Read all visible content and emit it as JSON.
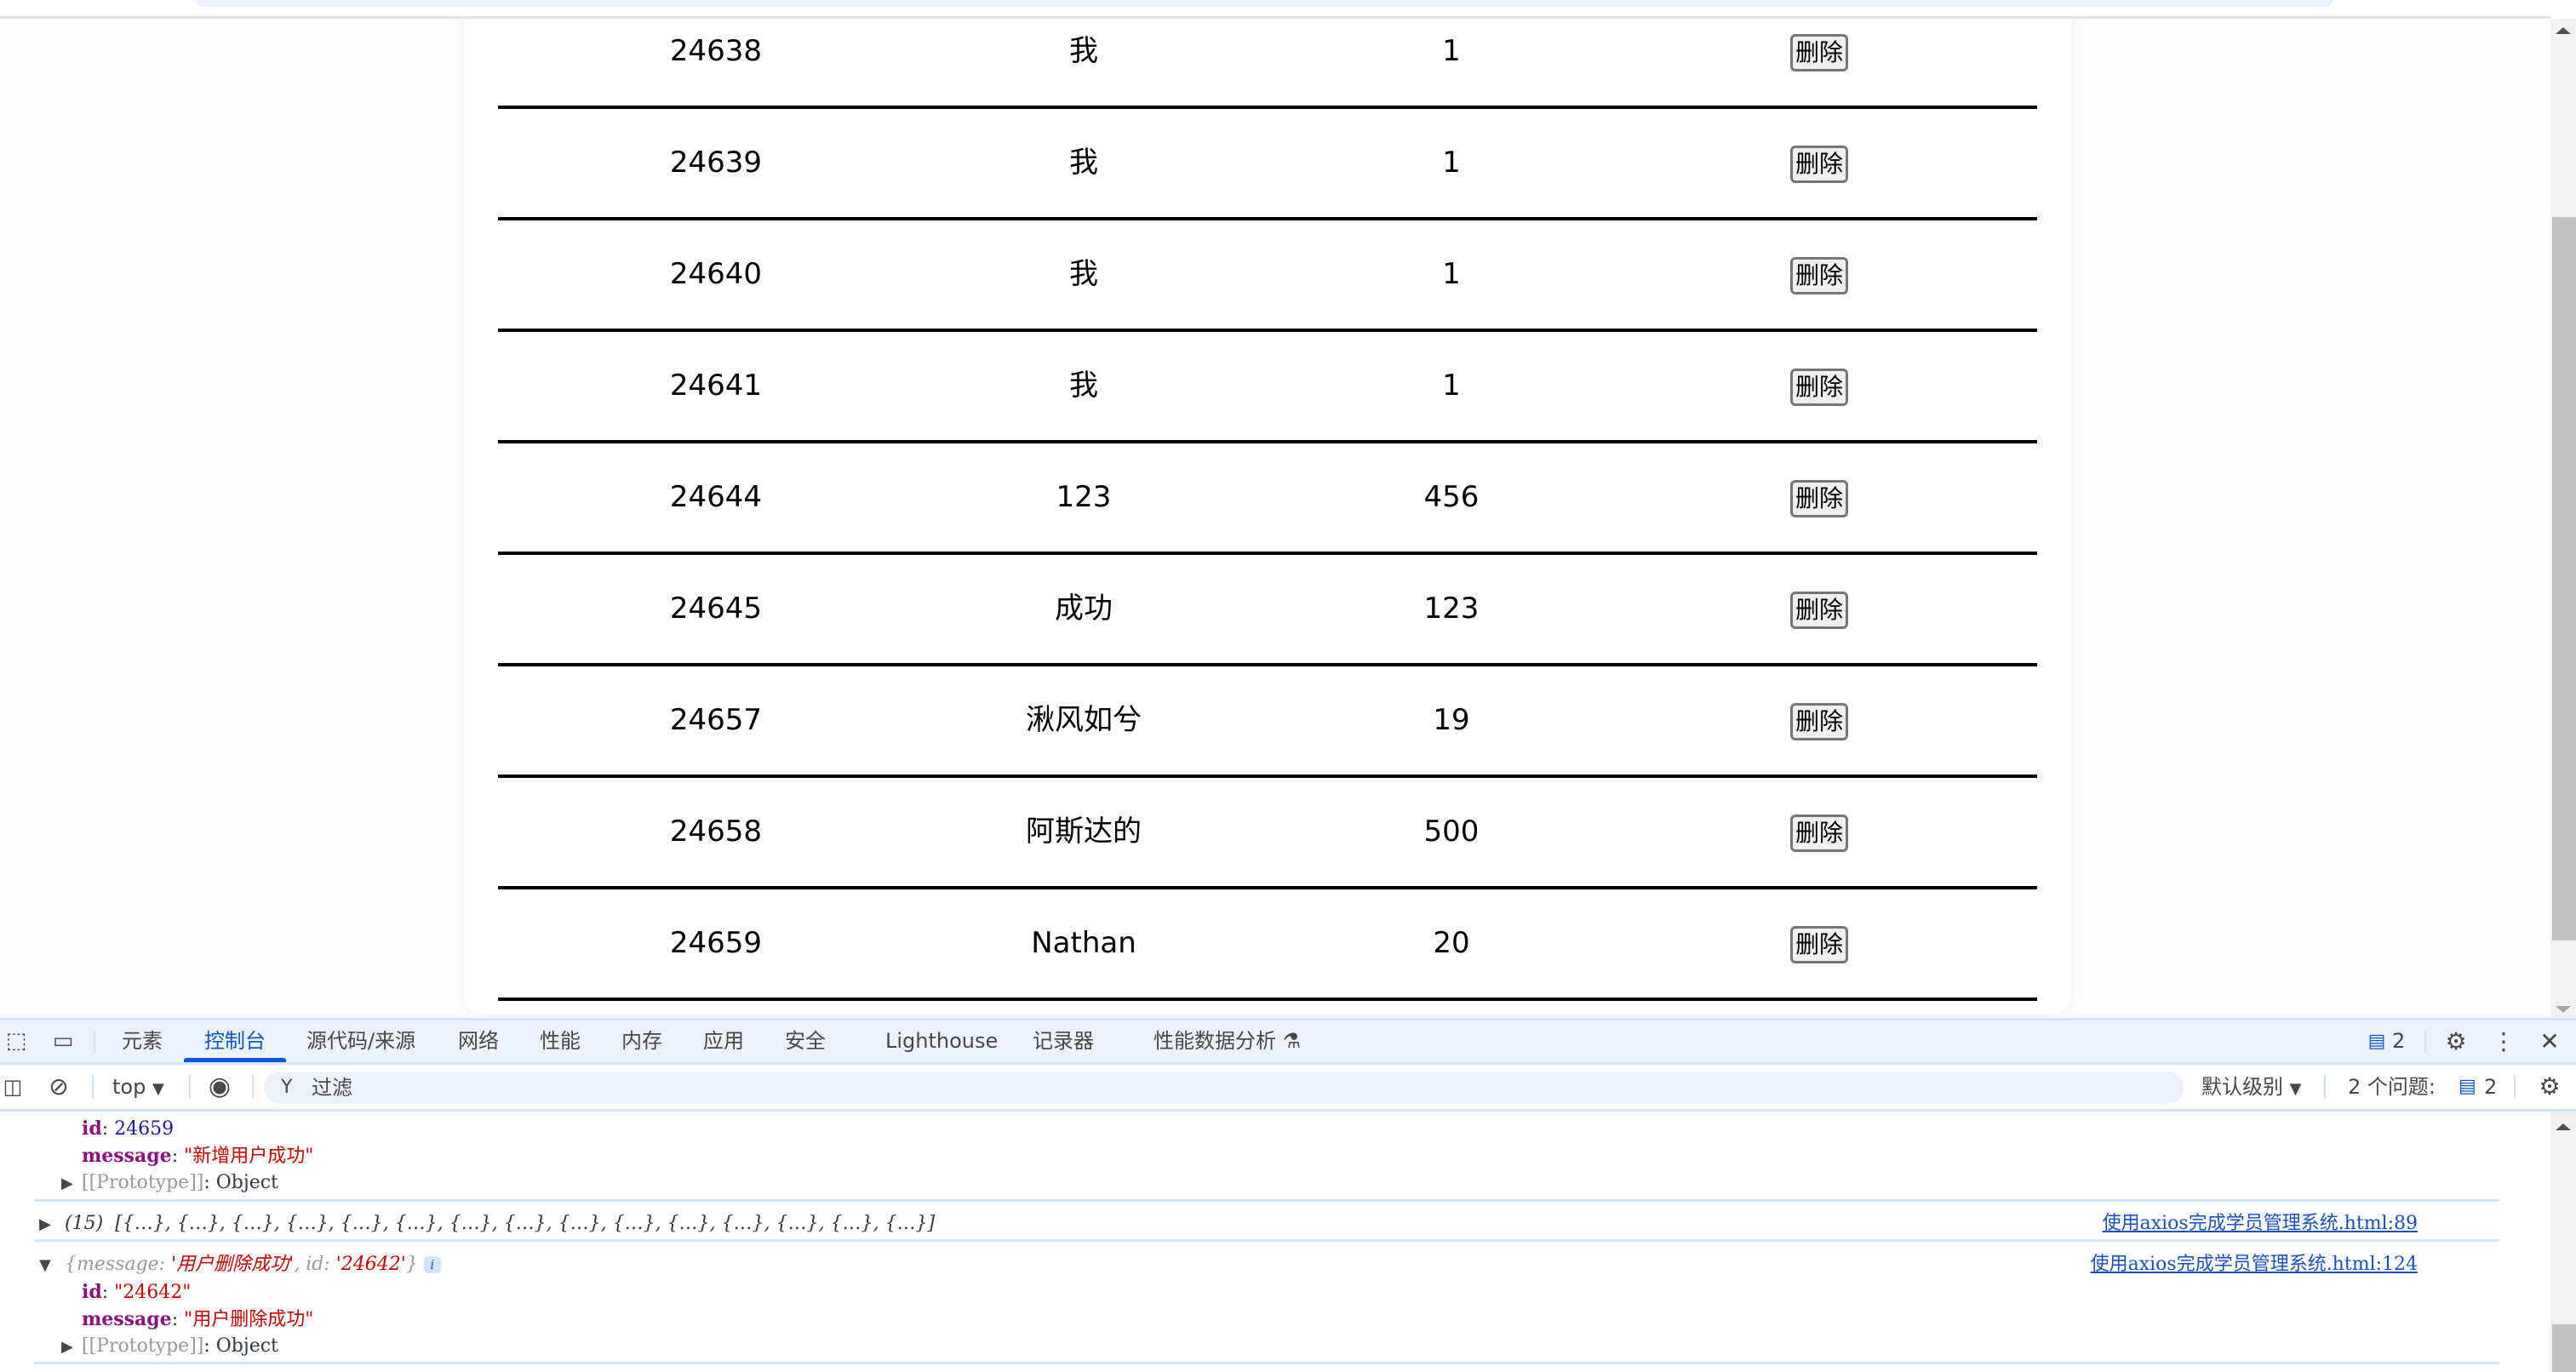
{
  "table": {
    "rows": [
      {
        "id": "24638",
        "name": "我",
        "age": "1",
        "action": "删除"
      },
      {
        "id": "24639",
        "name": "我",
        "age": "1",
        "action": "删除"
      },
      {
        "id": "24640",
        "name": "我",
        "age": "1",
        "action": "删除"
      },
      {
        "id": "24641",
        "name": "我",
        "age": "1",
        "action": "删除"
      },
      {
        "id": "24644",
        "name": "123",
        "age": "456",
        "action": "删除"
      },
      {
        "id": "24645",
        "name": "成功",
        "age": "123",
        "action": "删除"
      },
      {
        "id": "24657",
        "name": "湫风如兮",
        "age": "19",
        "action": "删除"
      },
      {
        "id": "24658",
        "name": "阿斯达的",
        "age": "500",
        "action": "删除"
      },
      {
        "id": "24659",
        "name": "Nathan",
        "age": "20",
        "action": "删除"
      }
    ]
  },
  "devtools": {
    "tabs": [
      "元素",
      "控制台",
      "源代码/来源",
      "网络",
      "性能",
      "内存",
      "应用",
      "安全",
      "Lighthouse",
      "记录器",
      "性能数据分析"
    ],
    "active_tab": "控制台",
    "issues_badge_count": "2",
    "toolbar": {
      "context": "top",
      "filter_placeholder": "过滤",
      "level": "默认级别",
      "issues_label": "2 个问题:",
      "issues_count": "2"
    },
    "console": {
      "entry1": {
        "id_key": "id",
        "id_value": "24659",
        "message_key": "message",
        "message_value": "\"新增用户成功\"",
        "prototype": "[[Prototype]]",
        "prototype_value": "Object"
      },
      "entry2": {
        "count": "(15)",
        "preview": "[{…}, {…}, {…}, {…}, {…}, {…}, {…}, {…}, {…}, {…}, {…}, {…}, {…}, {…}, {…}]",
        "source": "使用axios完成学员管理系统.html:89"
      },
      "entry3": {
        "summary_prefix": "{message: ",
        "summary_message": "'用户删除成功'",
        "summary_mid": ", id: ",
        "summary_id": "'24642'",
        "summary_suffix": "}",
        "info": "i",
        "id_key": "id",
        "id_value": "\"24642\"",
        "message_key": "message",
        "message_value": "\"用户删除成功\"",
        "prototype": "[[Prototype]]",
        "prototype_value": "Object",
        "source": "使用axios完成学员管理系统.html:124"
      }
    }
  }
}
